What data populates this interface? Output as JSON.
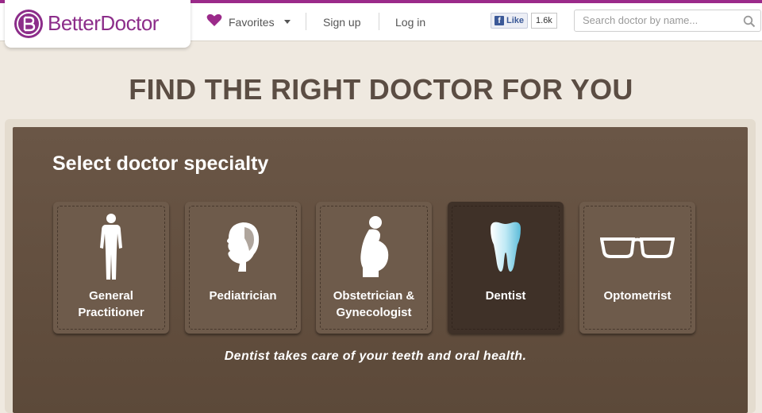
{
  "header": {
    "logo_text": "BetterDoctor",
    "nav": {
      "favorites_label": "Favorites",
      "signup_label": "Sign up",
      "login_label": "Log in"
    },
    "facebook": {
      "like_label": "Like",
      "count": "1.6k"
    },
    "search": {
      "placeholder": "Search doctor by name..."
    }
  },
  "hero": {
    "title": "FIND THE RIGHT DOCTOR FOR YOU"
  },
  "specialty_panel": {
    "heading": "Select doctor specialty",
    "tiles": [
      {
        "label": "General Practitioner",
        "icon": "human-body-icon",
        "selected": false
      },
      {
        "label": "Pediatrician",
        "icon": "child-head-icon",
        "selected": false
      },
      {
        "label": "Obstetrician & Gynecologist",
        "icon": "pregnant-woman-icon",
        "selected": false
      },
      {
        "label": "Dentist",
        "icon": "tooth-icon",
        "selected": true
      },
      {
        "label": "Optometrist",
        "icon": "eyeglasses-icon",
        "selected": false
      }
    ],
    "description": "Dentist takes care of your teeth and oral health."
  },
  "colors": {
    "brand": "#8c2d8a",
    "heart": "#9b2a8a",
    "panel_brown": "#5c4939",
    "selected_tile": "#3f3128",
    "tooth_blue": "#8fd3e8"
  }
}
